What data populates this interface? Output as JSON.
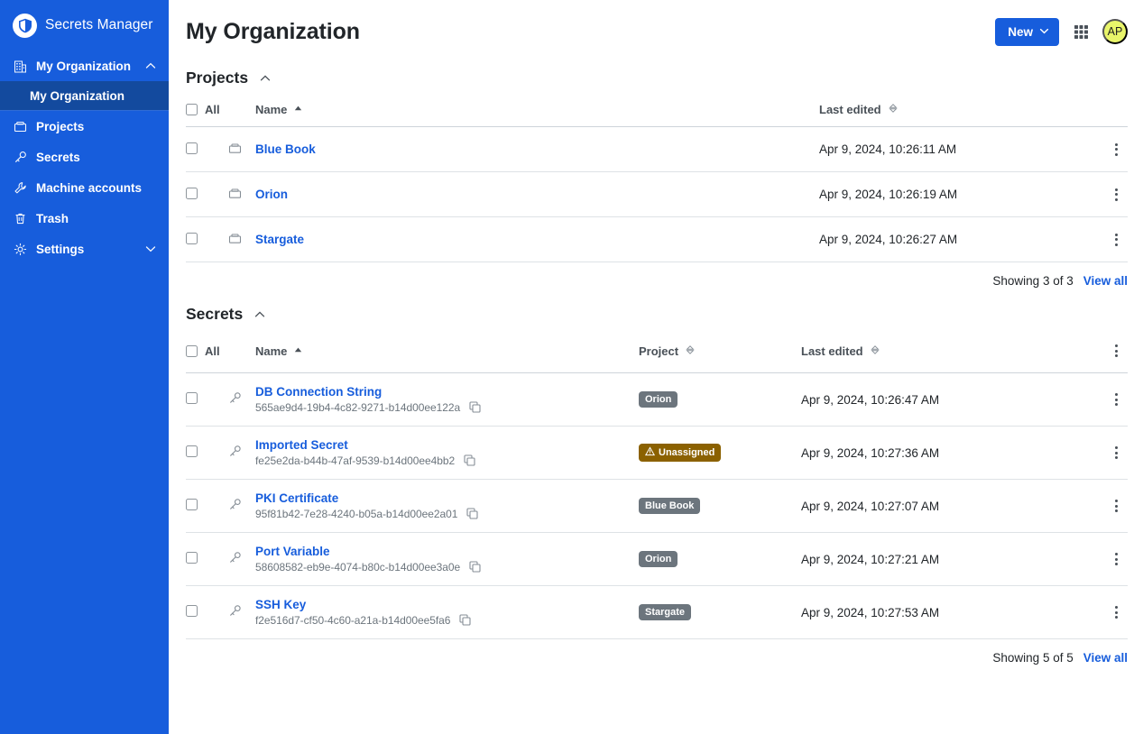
{
  "sidebar": {
    "brand": {
      "name": "Secrets Manager",
      "logo_icon": "shield-logo-icon"
    },
    "items": [
      {
        "label": "My Organization",
        "icon": "organization-icon",
        "chevron": "chevron-up-icon"
      },
      {
        "label": "Projects",
        "icon": "folder-icon"
      },
      {
        "label": "Secrets",
        "icon": "key-icon"
      },
      {
        "label": "Machine accounts",
        "icon": "wrench-icon"
      },
      {
        "label": "Trash",
        "icon": "trash-icon"
      },
      {
        "label": "Settings",
        "icon": "gear-icon",
        "chevron": "chevron-down-icon"
      }
    ],
    "active_sub_item": "My Organization"
  },
  "header": {
    "title": "My Organization",
    "new_button": {
      "label": "New",
      "icon": "chevron-down-icon"
    },
    "apps_icon": "grid-apps-icon",
    "avatar": {
      "initials": "AP"
    }
  },
  "projects_section": {
    "title": "Projects",
    "collapse_icon": "chevron-up-icon",
    "columns": {
      "all": "All",
      "name": "Name",
      "name_sort_icon": "sort-ascending-icon",
      "last_edited": "Last edited",
      "last_edited_sort_icon": "sort-icon"
    },
    "rows": [
      {
        "name": "Blue Book",
        "icon": "folder-icon",
        "last_edited": "Apr 9, 2024, 10:26:11 AM"
      },
      {
        "name": "Orion",
        "icon": "folder-icon",
        "last_edited": "Apr 9, 2024, 10:26:19 AM"
      },
      {
        "name": "Stargate",
        "icon": "folder-icon",
        "last_edited": "Apr 9, 2024, 10:26:27 AM"
      }
    ],
    "footer": {
      "showing": "Showing 3 of 3",
      "view_all": "View all"
    }
  },
  "secrets_section": {
    "title": "Secrets",
    "collapse_icon": "chevron-up-icon",
    "columns": {
      "all": "All",
      "name": "Name",
      "name_sort_icon": "sort-ascending-icon",
      "project": "Project",
      "project_sort_icon": "sort-icon",
      "last_edited": "Last edited",
      "last_edited_sort_icon": "sort-icon"
    },
    "rows": [
      {
        "name": "DB Connection String",
        "icon": "key-icon",
        "id": "565ae9d4-19b4-4c82-9271-b14d00ee122a",
        "copy_icon": "copy-icon",
        "project": "Orion",
        "project_warning": false,
        "last_edited": "Apr 9, 2024, 10:26:47 AM"
      },
      {
        "name": "Imported Secret",
        "icon": "key-icon",
        "id": "fe25e2da-b44b-47af-9539-b14d00ee4bb2",
        "copy_icon": "copy-icon",
        "project": "Unassigned",
        "project_warning": true,
        "last_edited": "Apr 9, 2024, 10:27:36 AM"
      },
      {
        "name": "PKI Certificate",
        "icon": "key-icon",
        "id": "95f81b42-7e28-4240-b05a-b14d00ee2a01",
        "copy_icon": "copy-icon",
        "project": "Blue Book",
        "project_warning": false,
        "last_edited": "Apr 9, 2024, 10:27:07 AM"
      },
      {
        "name": "Port Variable",
        "icon": "key-icon",
        "id": "58608582-eb9e-4074-b80c-b14d00ee3a0e",
        "copy_icon": "copy-icon",
        "project": "Orion",
        "project_warning": false,
        "last_edited": "Apr 9, 2024, 10:27:21 AM"
      },
      {
        "name": "SSH Key",
        "icon": "key-icon",
        "id": "f2e516d7-cf50-4c60-a21a-b14d00ee5fa6",
        "copy_icon": "copy-icon",
        "project": "Stargate",
        "project_warning": false,
        "last_edited": "Apr 9, 2024, 10:27:53 AM"
      }
    ],
    "footer": {
      "showing": "Showing 5 of 5",
      "view_all": "View all"
    }
  },
  "colors": {
    "sidebar_blue": "#175ddc",
    "sidebar_active": "#134a9e",
    "link_blue": "#175ddc",
    "badge_gray": "#6c757d",
    "badge_warn": "#8b6100",
    "avatar_bg": "#e9f56a"
  }
}
